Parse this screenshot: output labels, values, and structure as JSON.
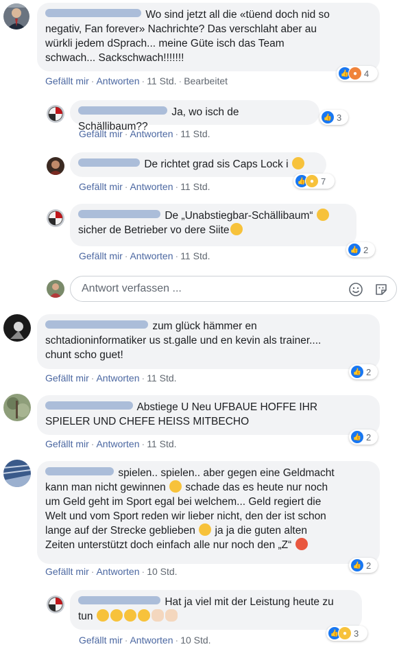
{
  "actions": {
    "like": "Gefällt mir",
    "reply": "Antworten",
    "sep": "·"
  },
  "composer": {
    "placeholder": "Antwort verfassen ..."
  },
  "comments": [
    {
      "lines": [
        "Wo sind jetzt all die «tüend doch nid so",
        "negativ, Fan forever» Nachrichte? Das verschlaht aber au",
        "würkli jedem dSprach... meine Güte isch das Team",
        "schwach... Sackschwach!!!!!!!"
      ],
      "time": "11 Std.",
      "edited": "Bearbeitet",
      "reaction_count": "4"
    },
    {
      "lines": [
        "Ja, wo isch de Schällibaum??"
      ],
      "time": "11 Std.",
      "reaction_count": "3"
    },
    {
      "lines": [
        "De richtet grad sis Caps Lock i"
      ],
      "time": "11 Std.",
      "reaction_count": "7"
    },
    {
      "lines": [
        "De „Unabstiegbar-Schällibaum“",
        "sicher de Betrieber vo dere Siite"
      ],
      "time": "11 Std.",
      "reaction_count": "2"
    },
    {
      "lines": [
        "zum glück hämmer en",
        "schtadioninformatiker us st.galle und en kevin als trainer....",
        "chunt scho guet!"
      ],
      "time": "11 Std.",
      "reaction_count": "2"
    },
    {
      "lines": [
        "Abstiege U Neu UFBAUE HOFFE IHR",
        "SPIELER UND CHEFE HEISS MITBECHO"
      ],
      "time": "11 Std.",
      "reaction_count": "2"
    },
    {
      "lines": [
        "spielen.. spielen.. aber gegen eine Geldmacht",
        "kann man nicht gewinnen",
        "schade das es heute nur noch",
        "um Geld geht im Sport egal bei welchem... Geld regiert die",
        "Welt und vom Sport reden wir lieber nicht, den der ist schon",
        "lange auf der Strecke geblieben",
        "ja ja die guten alten",
        "Zeiten unterstützt doch einfach alle nur noch den „Z“"
      ],
      "time": "10 Std.",
      "reaction_count": "2"
    },
    {
      "lines": [
        "Hat ja viel mit der Leistung heute zu",
        "tun"
      ],
      "time": "10 Std.",
      "reaction_count": "3"
    }
  ]
}
